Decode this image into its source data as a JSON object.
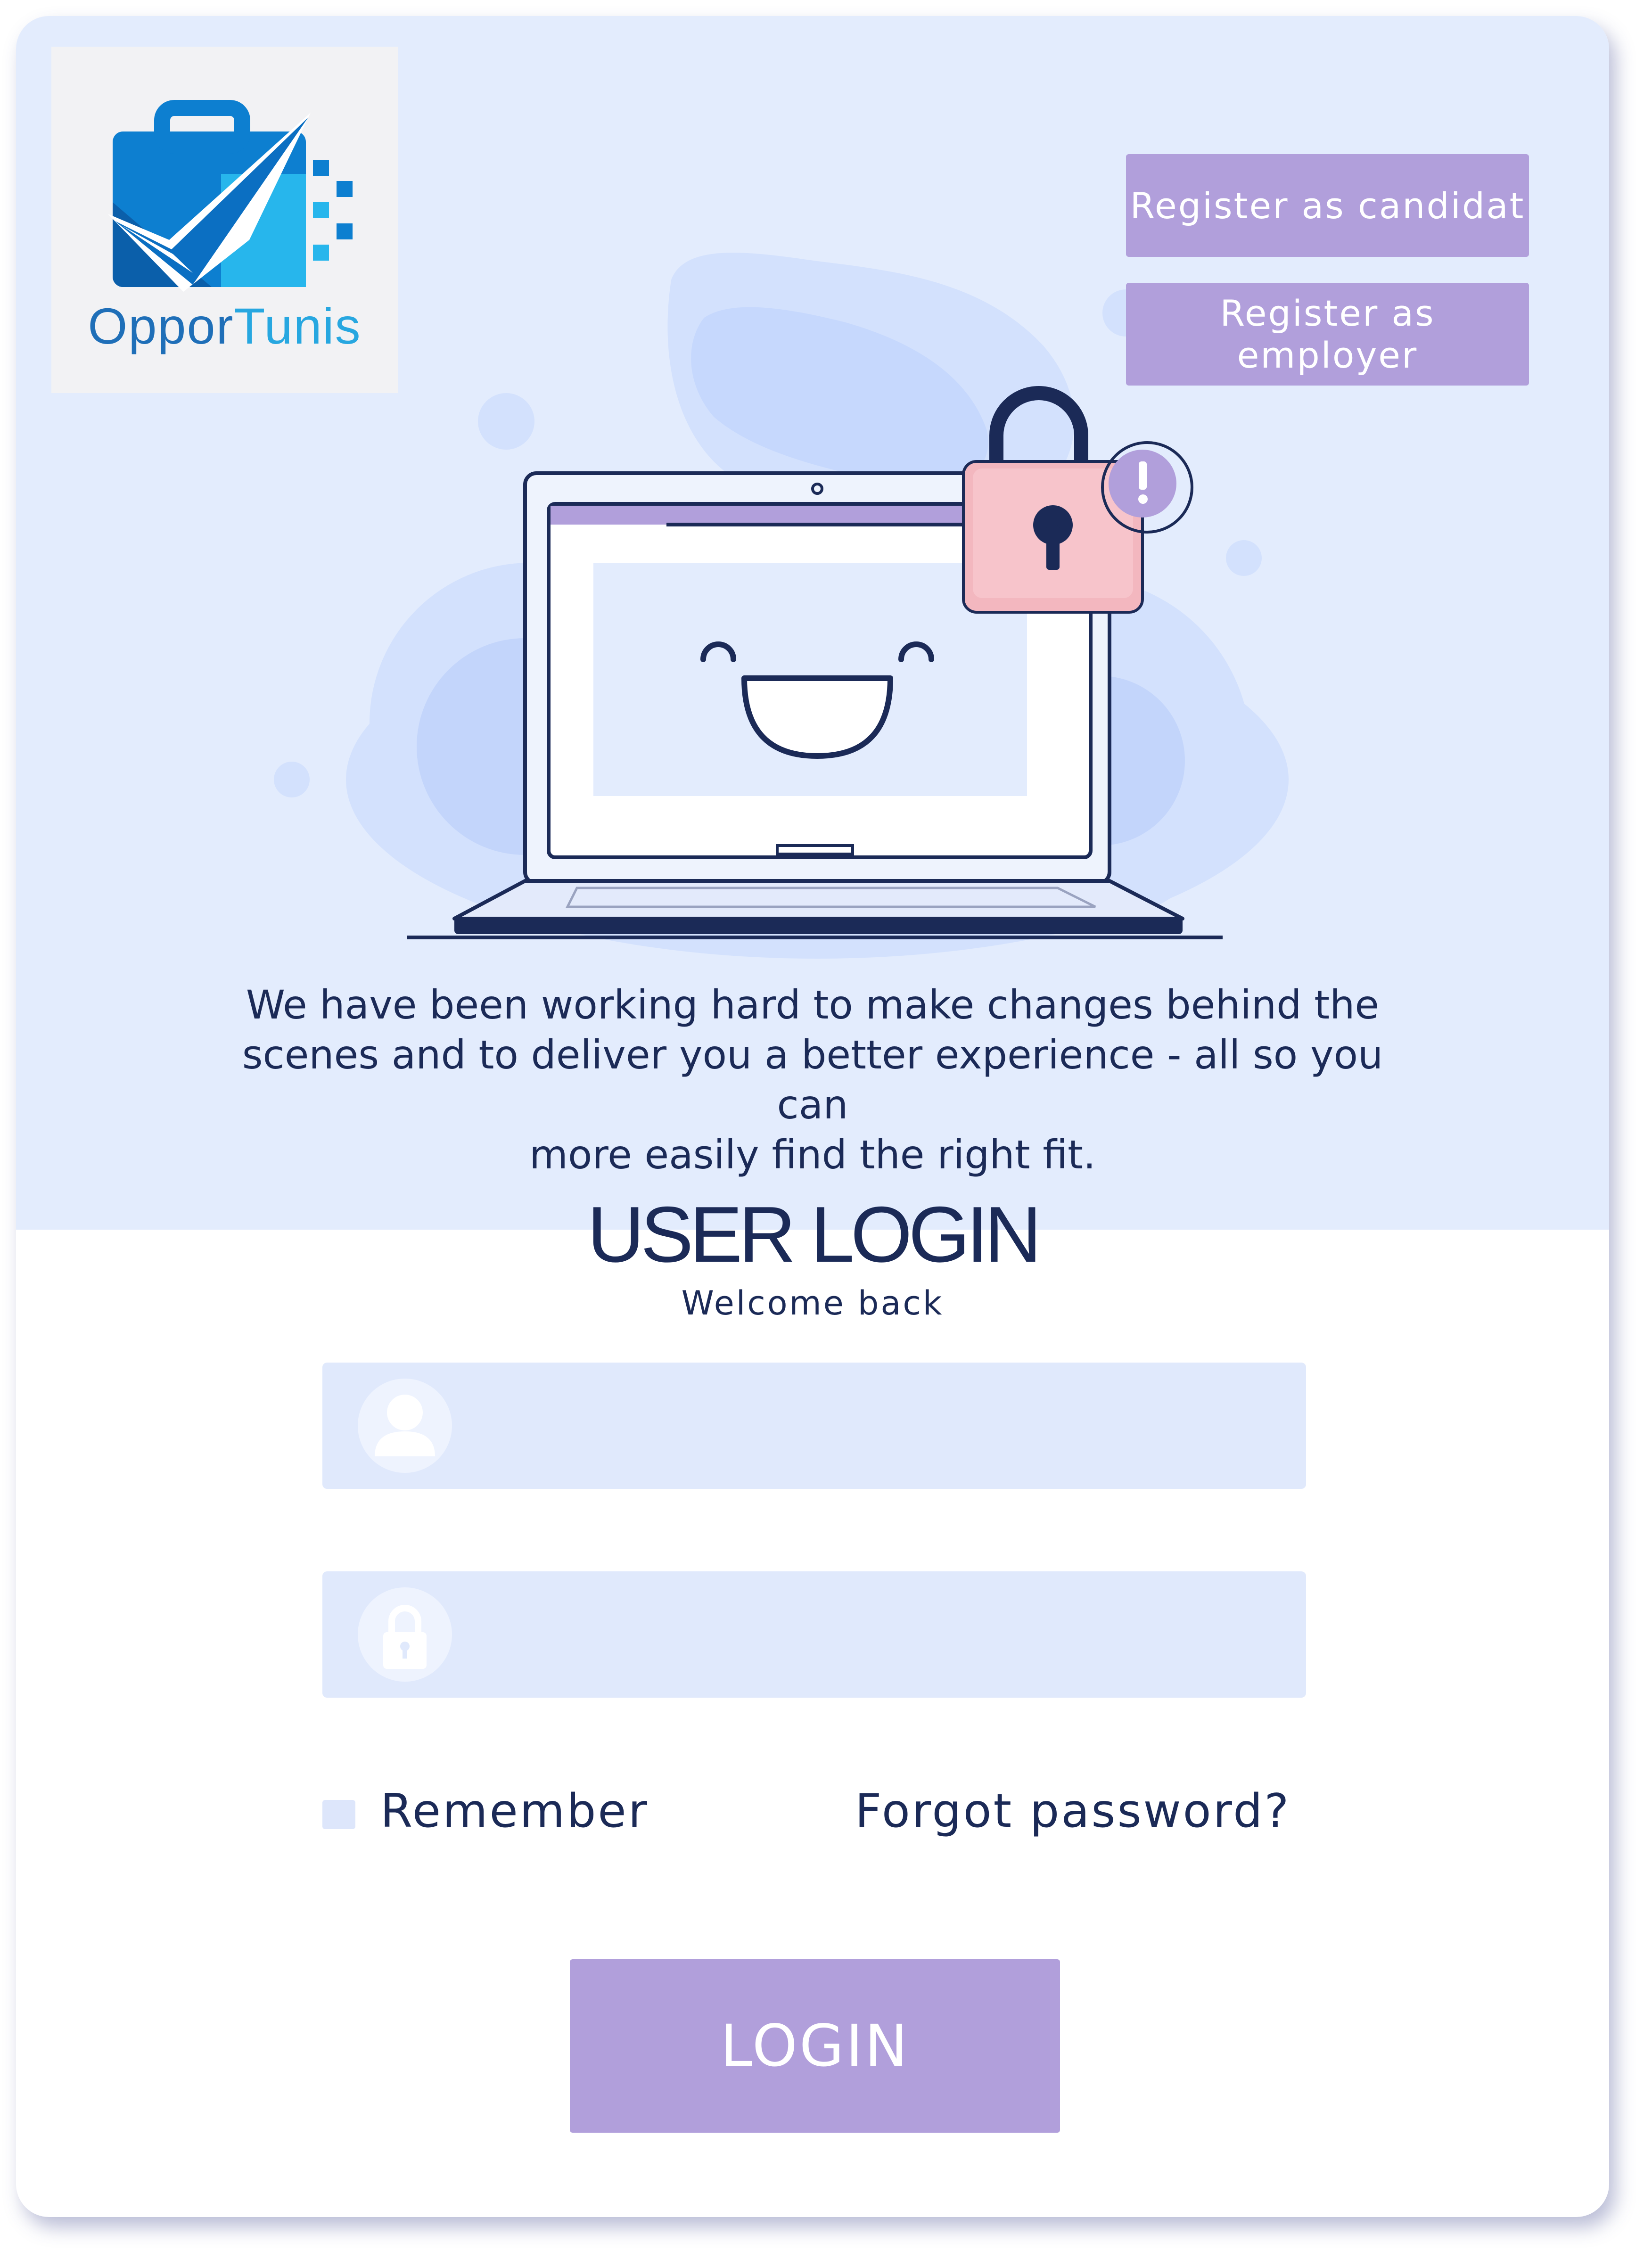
{
  "brand": {
    "name_part1": "Oppor",
    "name_part2": "Tunis",
    "colors": {
      "primary": "#1f6fb8",
      "light": "#27a7e0",
      "accent": "#b19fdb",
      "text": "#1b2a57"
    }
  },
  "header": {
    "register_candidate_label": "Register as candidat",
    "register_employer_label": "Register as employer"
  },
  "intro": {
    "line1": "We have been working hard to make changes behind the",
    "line2": "scenes and to deliver you a better experience - all so you can",
    "line3": "more easily find the right fit."
  },
  "login": {
    "title": "USER LOGIN",
    "subtitle": "Welcome back",
    "username": {
      "icon": "user-icon",
      "value": "",
      "placeholder": ""
    },
    "password": {
      "icon": "lock-icon",
      "value": "",
      "placeholder": ""
    },
    "remember_label": "Remember",
    "remember_checked": false,
    "forgot_label": "Forgot password?",
    "submit_label": "LOGIN"
  }
}
